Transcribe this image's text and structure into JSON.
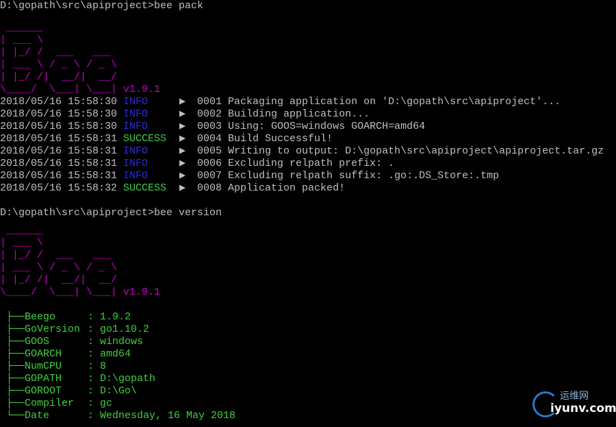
{
  "cmd1": "D:\\gopath\\src\\apiproject>bee pack",
  "logo": {
    "art": [
      " ______",
      "| ___ \\",
      "| |_/ /  ___   ___",
      "| ___ \\ / _ \\ / _ \\",
      "| |_/ /|  __/|  __/",
      "\\____/  \\___| \\___|"
    ],
    "version": "v1.9.1"
  },
  "logs": [
    {
      "ts": "2018/05/16 15:58:30",
      "level": "INFO",
      "kind": "info",
      "msg": "0001 Packaging application on 'D:\\gopath\\src\\apiproject'..."
    },
    {
      "ts": "2018/05/16 15:58:30",
      "level": "INFO",
      "kind": "info",
      "msg": "0002 Building application..."
    },
    {
      "ts": "2018/05/16 15:58:30",
      "level": "INFO",
      "kind": "info",
      "msg": "0003 Using: GOOS=windows GOARCH=amd64"
    },
    {
      "ts": "2018/05/16 15:58:31",
      "level": "SUCCESS",
      "kind": "success",
      "msg": "0004 Build Successful!"
    },
    {
      "ts": "2018/05/16 15:58:31",
      "level": "INFO",
      "kind": "info",
      "msg": "0005 Writing to output: D:\\gopath\\src\\apiproject\\apiproject.tar.gz"
    },
    {
      "ts": "2018/05/16 15:58:31",
      "level": "INFO",
      "kind": "info",
      "msg": "0006 Excluding relpath prefix: ."
    },
    {
      "ts": "2018/05/16 15:58:31",
      "level": "INFO",
      "kind": "info",
      "msg": "0007 Excluding relpath suffix: .go:.DS_Store:.tmp"
    },
    {
      "ts": "2018/05/16 15:58:32",
      "level": "SUCCESS",
      "kind": "success",
      "msg": "0008 Application packed!"
    }
  ],
  "arrow_glyph": "▶",
  "cmd2": "D:\\gopath\\src\\apiproject>bee version",
  "tree": [
    {
      "key": "Beego",
      "value": "1.9.2"
    },
    {
      "key": "GoVersion",
      "value": "go1.10.2"
    },
    {
      "key": "GOOS",
      "value": "windows"
    },
    {
      "key": "GOARCH",
      "value": "amd64"
    },
    {
      "key": "NumCPU",
      "value": "8"
    },
    {
      "key": "GOPATH",
      "value": "D:\\gopath"
    },
    {
      "key": "GOROOT",
      "value": "D:\\Go\\"
    },
    {
      "key": "Compiler",
      "value": "gc"
    },
    {
      "key": "Date",
      "value": "Wednesday, 16 May 2018"
    }
  ],
  "watermark": {
    "cn": "运维网",
    "en": "iyunv.com"
  },
  "colors": {
    "info": "#2b2bd6",
    "success": "#3fd13f",
    "logo": "#cc00cc",
    "text": "#c0c0c0"
  }
}
